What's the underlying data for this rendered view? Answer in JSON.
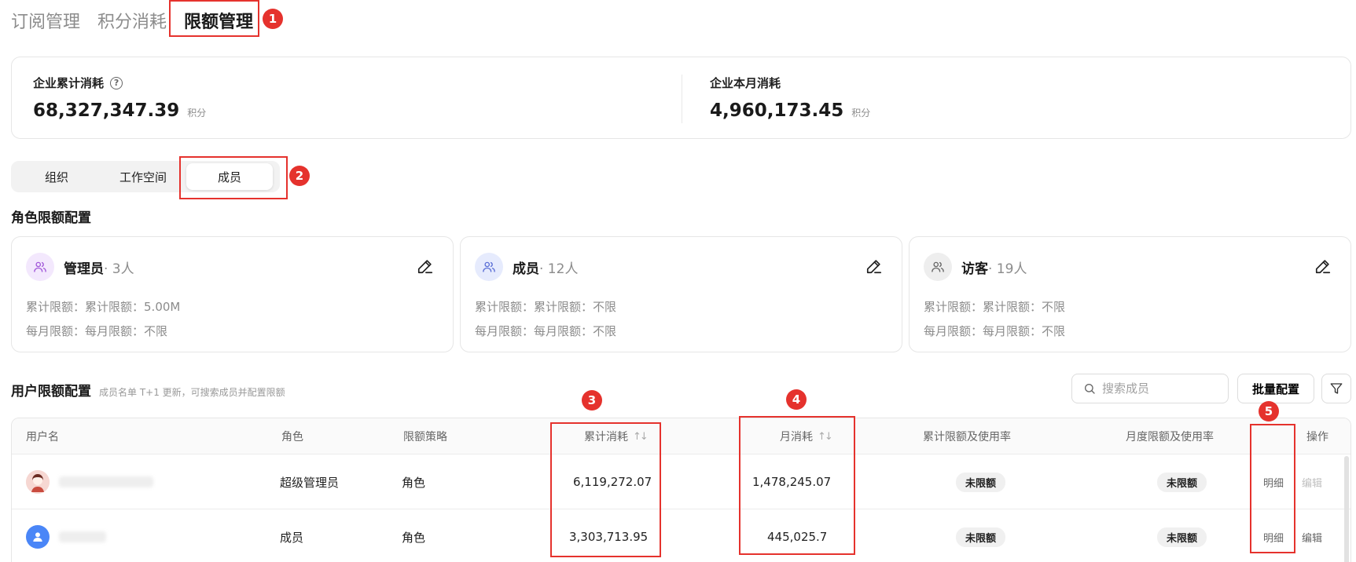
{
  "top_tabs": [
    {
      "label": "订阅管理",
      "active": false
    },
    {
      "label": "积分消耗",
      "active": false
    },
    {
      "label": "限额管理",
      "active": true
    }
  ],
  "summary": {
    "total": {
      "label": "企业累计消耗",
      "value": "68,327,347.39",
      "unit": "积分"
    },
    "month": {
      "label": "企业本月消耗",
      "value": "4,960,173.45",
      "unit": "积分"
    }
  },
  "segments": [
    {
      "label": "组织",
      "active": false
    },
    {
      "label": "工作空间",
      "active": false
    },
    {
      "label": "成员",
      "active": true
    }
  ],
  "role_section": {
    "title": "角色限额配置"
  },
  "roles": [
    {
      "name": "管理员",
      "count": "· 3人",
      "total_limit": "累计限额：累计限额：5.00M",
      "monthly_limit": "每月限额：每月限额：不限",
      "icon_color": "#f3e8fd",
      "icon_stroke": "#a259d9"
    },
    {
      "name": "成员",
      "count": "· 12人",
      "total_limit": "累计限额：累计限额：不限",
      "monthly_limit": "每月限额：每月限额：不限",
      "icon_color": "#e6ebfd",
      "icon_stroke": "#5b6fd6"
    },
    {
      "name": "访客",
      "count": "· 19人",
      "total_limit": "累计限额：累计限额：不限",
      "monthly_limit": "每月限额：每月限额：不限",
      "icon_color": "#eeeeee",
      "icon_stroke": "#666666"
    }
  ],
  "user_section": {
    "title": "用户限额配置",
    "subtitle": "成员名单 T+1 更新，可搜索成员并配置限额",
    "search_placeholder": "搜索成员",
    "batch_label": "批量配置"
  },
  "table": {
    "headers": {
      "username": "用户名",
      "role": "角色",
      "policy": "限额策略",
      "total_consumption": "累计消耗",
      "monthly_consumption": "月消耗",
      "total_limit_usage": "累计限额及使用率",
      "monthly_limit_usage": "月度限额及使用率",
      "actions": "操作"
    },
    "rows": [
      {
        "role": "超级管理员",
        "policy": "角色",
        "total": "6,119,272.07",
        "monthly": "1,478,245.07",
        "total_limit": "未限额",
        "monthly_limit": "未限额",
        "detail": "明细",
        "edit": "编辑",
        "edit_disabled": true
      },
      {
        "role": "成员",
        "policy": "角色",
        "total": "3,303,713.95",
        "monthly": "445,025.7",
        "total_limit": "未限额",
        "monthly_limit": "未限额",
        "detail": "明细",
        "edit": "编辑",
        "edit_disabled": false
      }
    ]
  },
  "annotations": [
    "1",
    "2",
    "3",
    "4",
    "5"
  ],
  "colors": {
    "highlight": "#e5322d"
  }
}
